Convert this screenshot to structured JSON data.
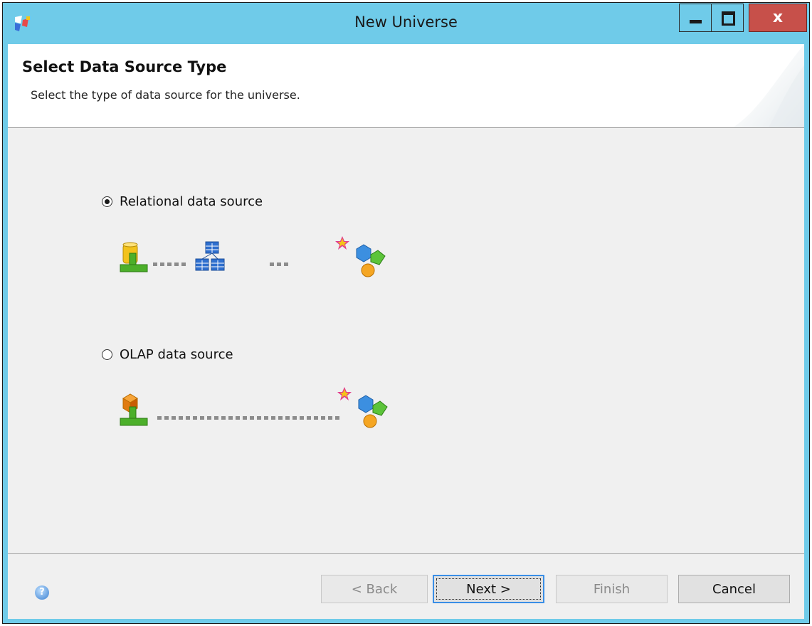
{
  "window": {
    "title": "New Universe",
    "close_glyph": "x"
  },
  "header": {
    "title": "Select Data Source Type",
    "subtitle": "Select the type of data source for the universe."
  },
  "options": [
    {
      "label": "Relational data source",
      "selected": true
    },
    {
      "label": "OLAP data source",
      "selected": false
    }
  ],
  "buttons": {
    "back": "< Back",
    "next": "Next >",
    "finish": "Finish",
    "cancel": "Cancel"
  },
  "help_glyph": "?",
  "colors": {
    "titlebar": "#6fcbe9",
    "close": "#c7504a",
    "client": "#f0f0f0",
    "default_button_border": "#3a8ee6"
  },
  "icons": {
    "app": "universe-designer-app-icon",
    "relational_source": "relational-database-connection-icon",
    "data_foundation": "data-foundation-tables-icon",
    "business_layer": "business-layer-icon",
    "olap_source": "olap-cube-connection-icon",
    "help": "help-icon"
  }
}
